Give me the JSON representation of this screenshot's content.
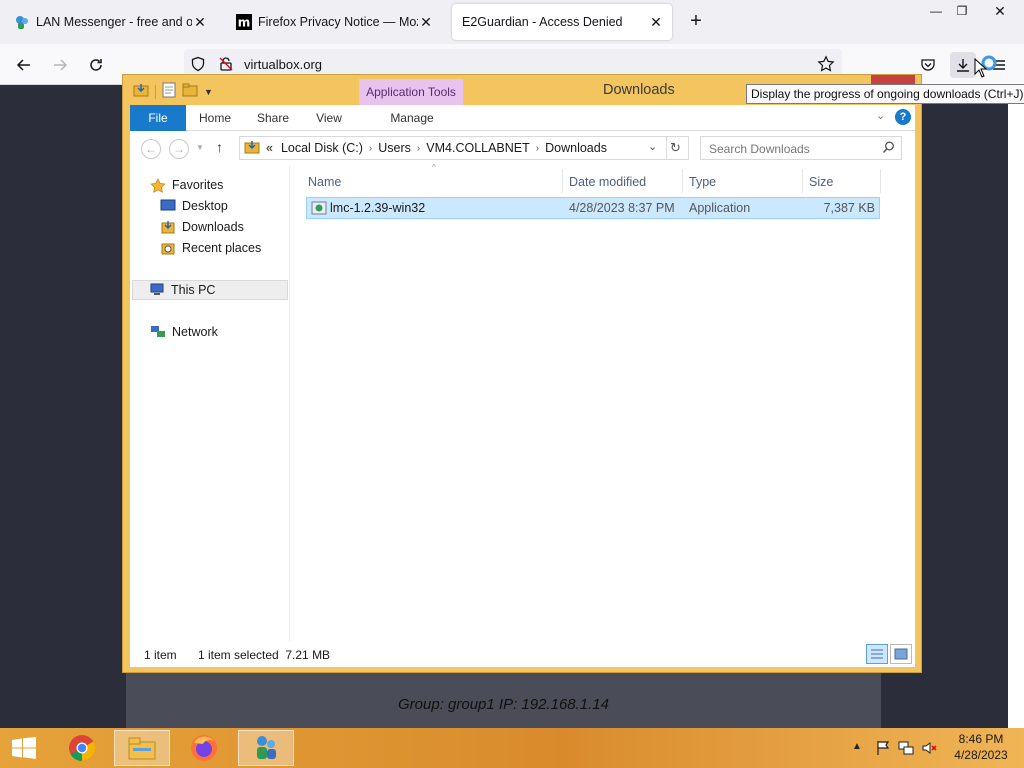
{
  "browser": {
    "tabs": [
      {
        "title": "LAN Messenger - free and open",
        "active": false
      },
      {
        "title": "Firefox Privacy Notice — Mozilla",
        "active": false
      },
      {
        "title": "E2Guardian - Access Denied",
        "active": true
      }
    ],
    "url": "virtualbox.org",
    "tooltip": "Display the progress of ongoing downloads (Ctrl+J)"
  },
  "explorer": {
    "title": "Downloads",
    "contextual_tab": "Application Tools",
    "ribbon_tabs": {
      "file": "File",
      "home": "Home",
      "share": "Share",
      "view": "View",
      "manage": "Manage"
    },
    "breadcrumb": {
      "prefix": "«",
      "items": [
        "Local Disk (C:)",
        "Users",
        "VM4.COLLABNET",
        "Downloads"
      ]
    },
    "search_placeholder": "Search Downloads",
    "nav": {
      "favorites": "Favorites",
      "desktop": "Desktop",
      "downloads": "Downloads",
      "recent": "Recent places",
      "this_pc": "This PC",
      "network": "Network"
    },
    "columns": {
      "name": "Name",
      "date": "Date modified",
      "type": "Type",
      "size": "Size"
    },
    "files": [
      {
        "name": "lmc-1.2.39-win32",
        "date": "4/28/2023 8:37 PM",
        "type": "Application",
        "size": "7,387 KB"
      }
    ],
    "status": {
      "count": "1 item",
      "selected": "1 item selected  7.21 MB"
    }
  },
  "desktop": {
    "group_ip": "Group: group1   IP: 192.168.1.14"
  },
  "taskbar": {
    "time": "8:46 PM",
    "date": "4/28/2023"
  },
  "colors": {
    "ribbon_file": "#1979ca",
    "explorer_frame": "#f4c55e",
    "taskbar": "#e6a33a",
    "selection": "#cce8ff"
  }
}
